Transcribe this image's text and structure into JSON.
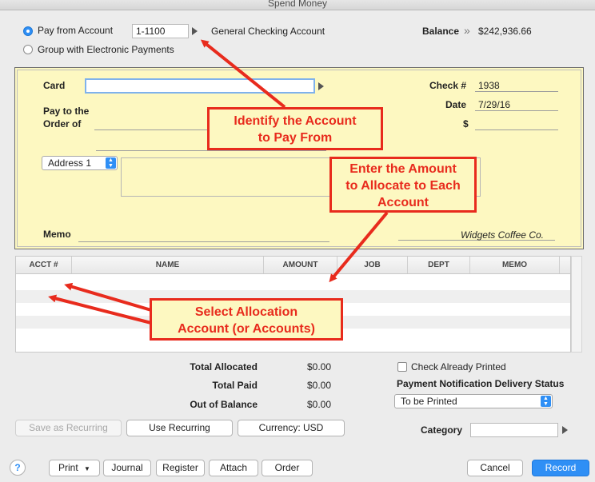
{
  "window": {
    "title": "Spend Money"
  },
  "pay_options": {
    "pay_from_account": "Pay from Account",
    "group_electronic": "Group with Electronic Payments",
    "account_number": "1-1100",
    "account_name": "General Checking Account"
  },
  "balance": {
    "label": "Balance",
    "arrow": "»",
    "value": "$242,936.66"
  },
  "check": {
    "card_label": "Card",
    "card_value": "",
    "pay_to_label_1": "Pay to the",
    "pay_to_label_2": "Order of",
    "check_no_label": "Check #",
    "check_no_value": "1938",
    "date_label": "Date",
    "date_value": "7/29/16",
    "amount_label": "$",
    "amount_value": "",
    "address_select": "Address 1",
    "memo_label": "Memo",
    "memo_value": "",
    "company_signature": "Widgets Coffee Co."
  },
  "grid": {
    "columns": [
      "ACCT #",
      "NAME",
      "AMOUNT",
      "JOB",
      "DEPT",
      "MEMO"
    ],
    "rows": []
  },
  "totals": {
    "allocated_label": "Total Allocated",
    "allocated_value": "$0.00",
    "paid_label": "Total Paid",
    "paid_value": "$0.00",
    "out_of_balance_label": "Out of Balance",
    "out_of_balance_value": "$0.00"
  },
  "options": {
    "check_printed_label": "Check Already Printed",
    "notification_label": "Payment Notification Delivery Status",
    "notification_value": "To be Printed",
    "category_label": "Category",
    "category_value": ""
  },
  "buttons": {
    "save_recurring": "Save as Recurring",
    "use_recurring": "Use Recurring",
    "currency": "Currency:  USD",
    "help": "?",
    "print": "Print",
    "journal": "Journal",
    "register": "Register",
    "attach": "Attach",
    "order": "Order",
    "cancel": "Cancel",
    "record": "Record"
  },
  "annotations": {
    "identify_1": "Identify the Account",
    "identify_2": "to Pay From",
    "enter_1": "Enter the Amount",
    "enter_2": "to Allocate to Each",
    "enter_3": "Account",
    "select_1": "Select Allocation",
    "select_2": "Account (or Accounts)"
  },
  "colors": {
    "accent": "#2f8ff5",
    "check_bg": "#fdf8c1",
    "annotation": "#e82b1d"
  }
}
